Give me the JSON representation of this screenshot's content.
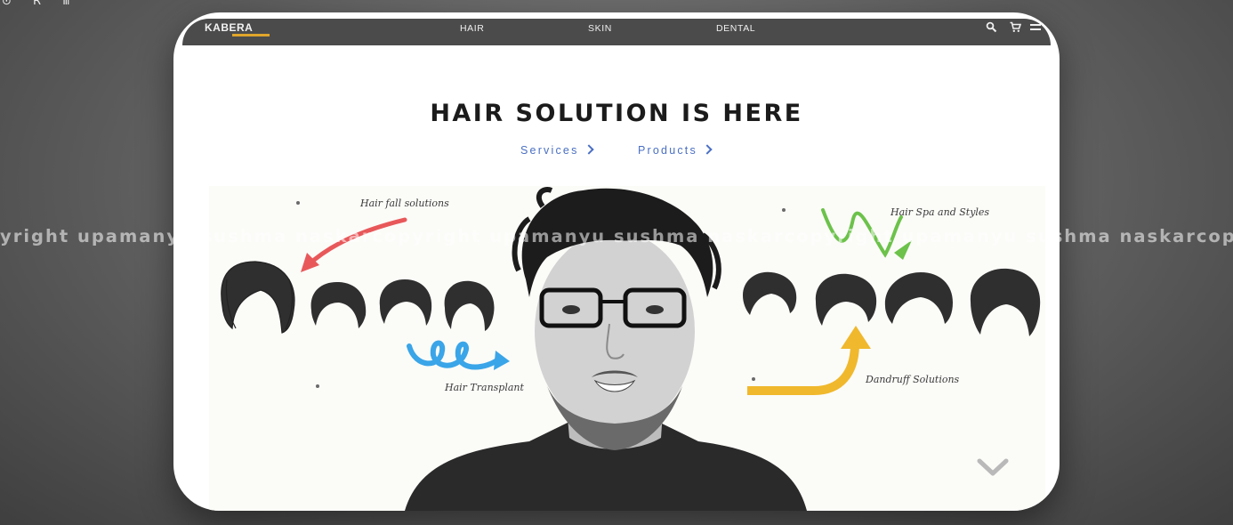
{
  "corner_glyphs": "⊙ R ⅲ",
  "nav": {
    "logo": "KABERA",
    "items": [
      "HAIR",
      "SKIN",
      "DENTAL"
    ],
    "icons": [
      "search-icon",
      "cart-icon",
      "menu-icon"
    ]
  },
  "hero": {
    "title": "HAIR SOLUTION IS HERE",
    "links": [
      "Services",
      "Products"
    ]
  },
  "annotations": {
    "hair_fall": "Hair fall solutions",
    "hair_spa": "Hair Spa and Styles",
    "hair_transplant": "Hair Transplant",
    "dandruff": "Dandruff Solutions"
  },
  "watermark": "yright upamanyu sushma naskarcopyright upamanyu sushma naskarcopyright upamanyu sushma naskarcopyright up",
  "colors": {
    "topbar": "#4b4b4b",
    "logo_underline": "#e0a52a",
    "link": "#4a6fc4",
    "arrow_red": "#e8585a",
    "arrow_green": "#6cc24a",
    "arrow_blue": "#3aa5e8",
    "arrow_yellow": "#f0b82c"
  }
}
